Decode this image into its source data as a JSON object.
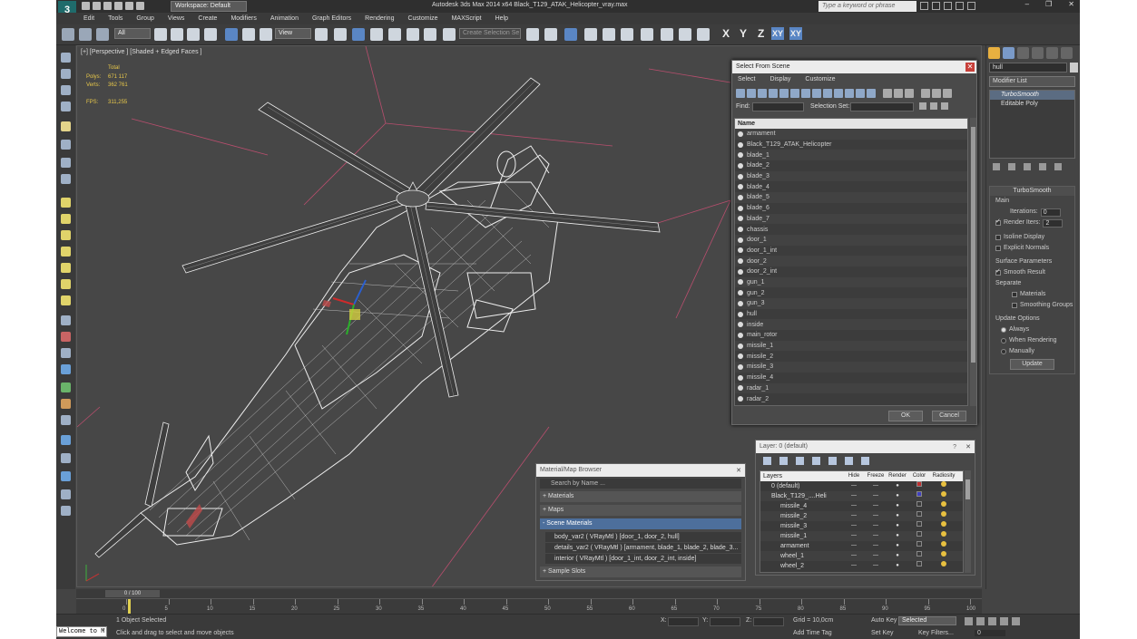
{
  "app": {
    "title": "Autodesk 3ds Max  2014 x64     Black_T129_ATAK_Helicopter_vray.max",
    "workspace": "Workspace: Default",
    "search_placeholder": "Type a keyword or phrase"
  },
  "menu": [
    "Edit",
    "Tools",
    "Group",
    "Views",
    "Create",
    "Modifiers",
    "Animation",
    "Graph Editors",
    "Rendering",
    "Customize",
    "MAXScript",
    "Help"
  ],
  "toolbar": {
    "selection_filter": "All",
    "ref_coord": "View",
    "selection_set": "Create Selection Se",
    "axis_x": "X",
    "axis_y": "Y",
    "axis_z": "Z",
    "axis_xy": "XY",
    "axis_xyz": "XY"
  },
  "viewport": {
    "label": "[+] [Perspective ] [Shaded + Edged Faces ]",
    "stats": {
      "total_label": "Total",
      "polys_label": "Polys:",
      "polys_value": "671 117",
      "verts_label": "Verts:",
      "verts_value": "362 761",
      "fps_label": "FPS:",
      "fps_value": "311,255"
    }
  },
  "command_panel": {
    "object_name": "hull",
    "modifier_list": "Modifier List",
    "stack": [
      "TurboSmooth",
      "Editable Poly"
    ],
    "turbosmooth": {
      "title": "TurboSmooth",
      "main_label": "Main",
      "iterations_label": "Iterations:",
      "iterations_value": "0",
      "render_iters_label": "Render Iters:",
      "render_iters_value": "2",
      "isoline": "Isoline Display",
      "explicit_normals": "Explicit Normals",
      "surface_params": "Surface Parameters",
      "smooth_result": "Smooth Result",
      "separate": "Separate",
      "materials": "Materials",
      "smoothing_groups": "Smoothing Groups",
      "update_options": "Update Options",
      "always": "Always",
      "when_rendering": "When Rendering",
      "manually": "Manually",
      "update_button": "Update"
    }
  },
  "select_from_scene": {
    "title": "Select From Scene",
    "menu": [
      "Select",
      "Display",
      "Customize"
    ],
    "find_label": "Find:",
    "selection_set_label": "Selection Set:",
    "column_name": "Name",
    "items": [
      "armament",
      "Black_T129_ATAK_Helicopter",
      "blade_1",
      "blade_2",
      "blade_3",
      "blade_4",
      "blade_5",
      "blade_6",
      "blade_7",
      "chassis",
      "door_1",
      "door_1_int",
      "door_2",
      "door_2_int",
      "gun_1",
      "gun_2",
      "gun_3",
      "hull",
      "inside",
      "main_rotor",
      "missile_1",
      "missile_2",
      "missile_3",
      "missile_4",
      "radar_1",
      "radar_2"
    ],
    "ok": "OK",
    "cancel": "Cancel"
  },
  "material_browser": {
    "title": "Material/Map Browser",
    "search": "Search by Name ...",
    "sections": [
      "+ Materials",
      "+ Maps",
      "- Scene Materials"
    ],
    "materials": [
      "body_var2  ( VRayMtl ) [door_1, door_2, hull]",
      "details_var2  ( VRayMtl ) [armament, blade_1, blade_2, blade_3...",
      "interior  ( VRayMtl ) [door_1_int, door_2_int, inside]"
    ],
    "sample_slots": "+ Sample Slots"
  },
  "layer_manager": {
    "title": "Layer: 0 (default)",
    "columns": [
      "Layers",
      "Hide",
      "Freeze",
      "Render",
      "Color",
      "Radiosity"
    ],
    "rows": [
      {
        "name": "0 (default)",
        "color": "#c03030"
      },
      {
        "name": "Black_T129_....Heli",
        "color": "#4040c0"
      },
      {
        "name": "missile_4",
        "color": "#3a3a3a"
      },
      {
        "name": "missile_2",
        "color": "#3a3a3a"
      },
      {
        "name": "missile_3",
        "color": "#3a3a3a"
      },
      {
        "name": "missile_1",
        "color": "#3a3a3a"
      },
      {
        "name": "armament",
        "color": "#3a3a3a"
      },
      {
        "name": "wheel_1",
        "color": "#3a3a3a"
      },
      {
        "name": "wheel_2",
        "color": "#3a3a3a"
      }
    ]
  },
  "timeline": {
    "frame": "0 / 100",
    "ticks": [
      "0",
      "5",
      "10",
      "15",
      "20",
      "25",
      "30",
      "35",
      "40",
      "45",
      "50",
      "55",
      "60",
      "65",
      "70",
      "75",
      "80",
      "85",
      "90",
      "95",
      "100"
    ]
  },
  "status": {
    "welcome": "Welcome to M",
    "selected": "1 Object Selected",
    "prompt": "Click and drag to select and move objects",
    "x_label": "X:",
    "y_label": "Y:",
    "z_label": "Z:",
    "grid": "Grid = 10,0cm",
    "add_time_tag": "Add Time Tag",
    "auto_key": "Auto Key",
    "auto_key_mode": "Selected",
    "set_key": "Set Key",
    "key_filters": "Key Filters...",
    "frame_value": "0"
  }
}
